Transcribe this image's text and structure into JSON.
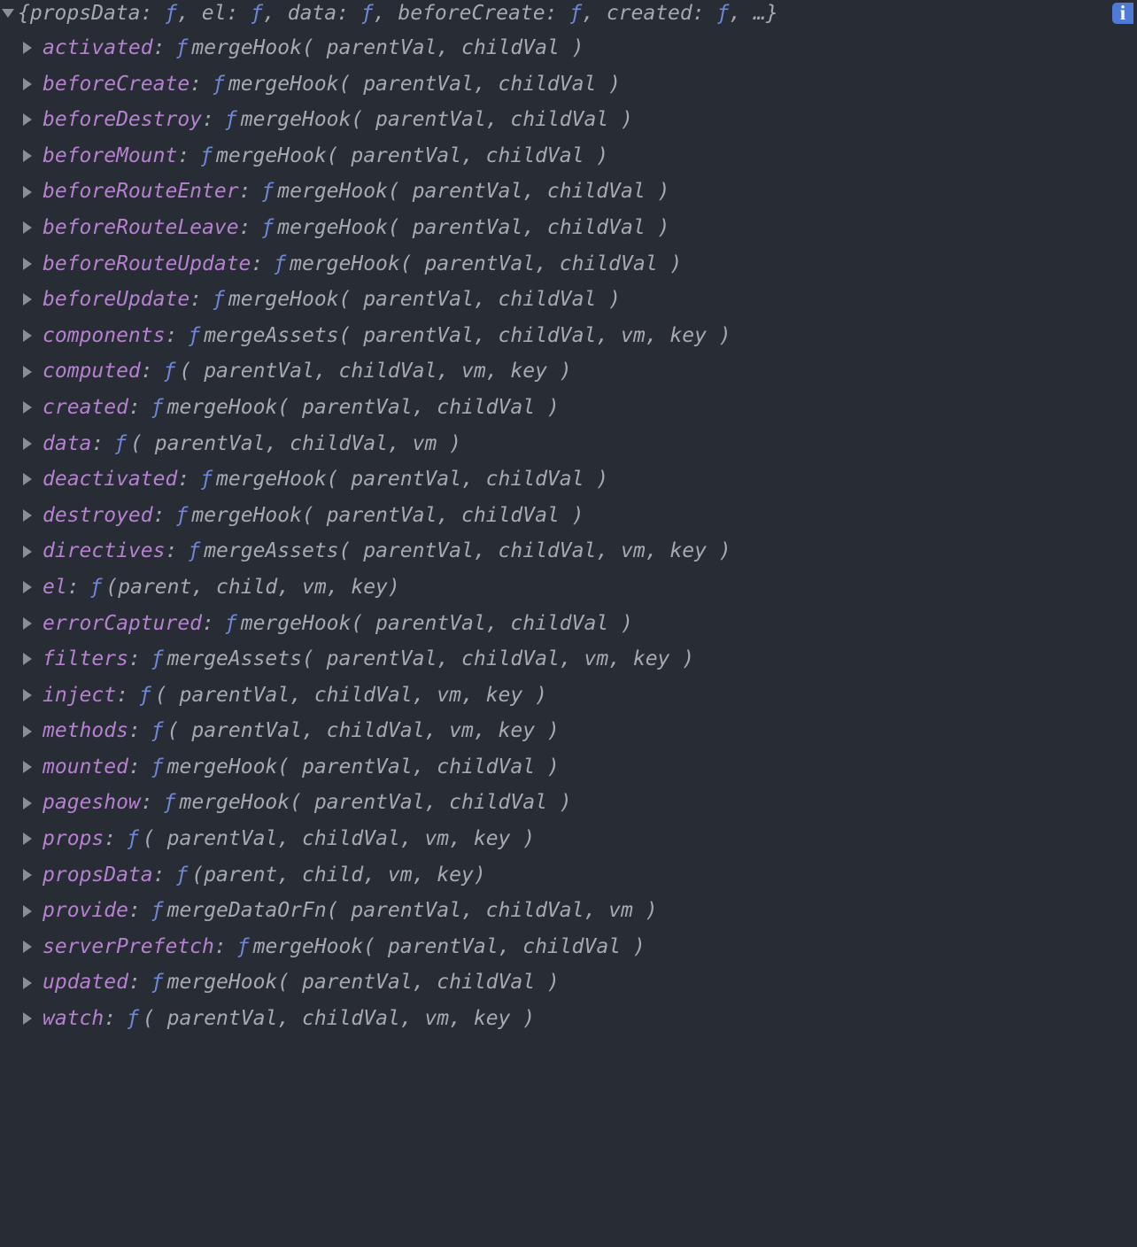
{
  "summary": {
    "open_brace": "{",
    "pairs": [
      {
        "k": "propsData",
        "sep": ": ",
        "f": "ƒ"
      },
      {
        "k": "el",
        "sep": ": ",
        "f": "ƒ"
      },
      {
        "k": "data",
        "sep": ": ",
        "f": "ƒ"
      },
      {
        "k": "beforeCreate",
        "sep": ": ",
        "f": "ƒ"
      },
      {
        "k": "created",
        "sep": ": ",
        "f": "ƒ"
      }
    ],
    "pair_delim": ", ",
    "tail": ", …}",
    "info": "i"
  },
  "f_glyph": "ƒ",
  "props": [
    {
      "key": "activated",
      "fn": "mergeHook",
      "args": "( parentVal, childVal )"
    },
    {
      "key": "beforeCreate",
      "fn": "mergeHook",
      "args": "( parentVal, childVal )"
    },
    {
      "key": "beforeDestroy",
      "fn": "mergeHook",
      "args": "( parentVal, childVal )"
    },
    {
      "key": "beforeMount",
      "fn": "mergeHook",
      "args": "( parentVal, childVal )"
    },
    {
      "key": "beforeRouteEnter",
      "fn": "mergeHook",
      "args": "( parentVal, childVal )"
    },
    {
      "key": "beforeRouteLeave",
      "fn": "mergeHook",
      "args": "( parentVal, childVal )"
    },
    {
      "key": "beforeRouteUpdate",
      "fn": "mergeHook",
      "args": "( parentVal, childVal )"
    },
    {
      "key": "beforeUpdate",
      "fn": "mergeHook",
      "args": "( parentVal, childVal )"
    },
    {
      "key": "components",
      "fn": "mergeAssets",
      "args": "( parentVal, childVal, vm, key )"
    },
    {
      "key": "computed",
      "fn": "",
      "args": "( parentVal, childVal, vm, key )"
    },
    {
      "key": "created",
      "fn": "mergeHook",
      "args": "( parentVal, childVal )"
    },
    {
      "key": "data",
      "fn": "",
      "args": "( parentVal, childVal, vm )"
    },
    {
      "key": "deactivated",
      "fn": "mergeHook",
      "args": "( parentVal, childVal )"
    },
    {
      "key": "destroyed",
      "fn": "mergeHook",
      "args": "( parentVal, childVal )"
    },
    {
      "key": "directives",
      "fn": "mergeAssets",
      "args": "( parentVal, childVal, vm, key )"
    },
    {
      "key": "el",
      "fn": "",
      "args": "(parent, child, vm, key)"
    },
    {
      "key": "errorCaptured",
      "fn": "mergeHook",
      "args": "( parentVal, childVal )"
    },
    {
      "key": "filters",
      "fn": "mergeAssets",
      "args": "( parentVal, childVal, vm, key )"
    },
    {
      "key": "inject",
      "fn": "",
      "args": "( parentVal, childVal, vm, key )"
    },
    {
      "key": "methods",
      "fn": "",
      "args": "( parentVal, childVal, vm, key )"
    },
    {
      "key": "mounted",
      "fn": "mergeHook",
      "args": "( parentVal, childVal )"
    },
    {
      "key": "pageshow",
      "fn": "mergeHook",
      "args": "( parentVal, childVal )"
    },
    {
      "key": "props",
      "fn": "",
      "args": "( parentVal, childVal, vm, key )"
    },
    {
      "key": "propsData",
      "fn": "",
      "args": "(parent, child, vm, key)"
    },
    {
      "key": "provide",
      "fn": "mergeDataOrFn",
      "args": "( parentVal, childVal, vm )"
    },
    {
      "key": "serverPrefetch",
      "fn": "mergeHook",
      "args": "( parentVal, childVal )"
    },
    {
      "key": "updated",
      "fn": "mergeHook",
      "args": "( parentVal, childVal )"
    },
    {
      "key": "watch",
      "fn": "",
      "args": "( parentVal, childVal, vm, key )"
    }
  ]
}
